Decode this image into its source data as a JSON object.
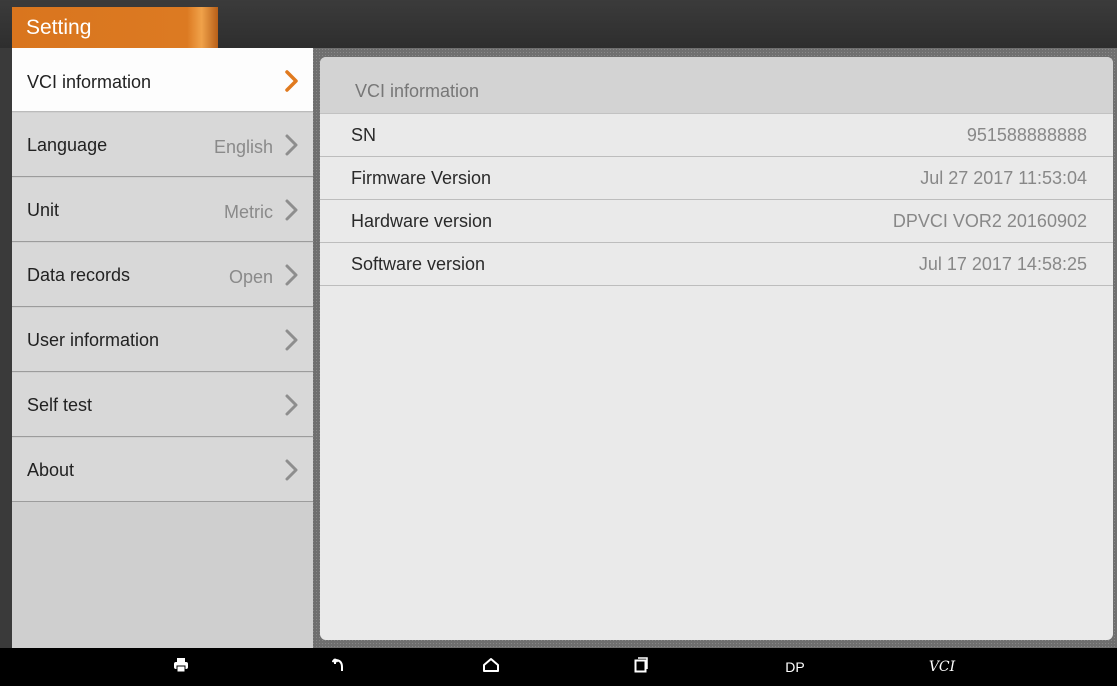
{
  "header": {
    "title": "Setting"
  },
  "sidebar": {
    "items": [
      {
        "label": "VCI information",
        "value": ""
      },
      {
        "label": "Language",
        "value": "English"
      },
      {
        "label": "Unit",
        "value": "Metric"
      },
      {
        "label": "Data records",
        "value": "Open"
      },
      {
        "label": "User information",
        "value": ""
      },
      {
        "label": "Self test",
        "value": ""
      },
      {
        "label": "About",
        "value": ""
      }
    ]
  },
  "panel": {
    "title": "VCI information",
    "rows": [
      {
        "key": "SN",
        "value": "951588888888"
      },
      {
        "key": "Firmware Version",
        "value": "Jul 27 2017 11:53:04"
      },
      {
        "key": "Hardware version",
        "value": "DPVCI VOR2 20160902"
      },
      {
        "key": "Software version",
        "value": "Jul 17 2017 14:58:25"
      }
    ]
  },
  "navbar": {
    "dp_label": "DP",
    "vci_label": "VCI"
  },
  "colors": {
    "accent": "#d9751e",
    "active_chevron": "#e07a1f",
    "chevron": "#8e8e8e"
  },
  "icons": [
    "chevron-right-icon",
    "printer-icon",
    "back-icon",
    "home-icon",
    "recent-apps-icon"
  ]
}
